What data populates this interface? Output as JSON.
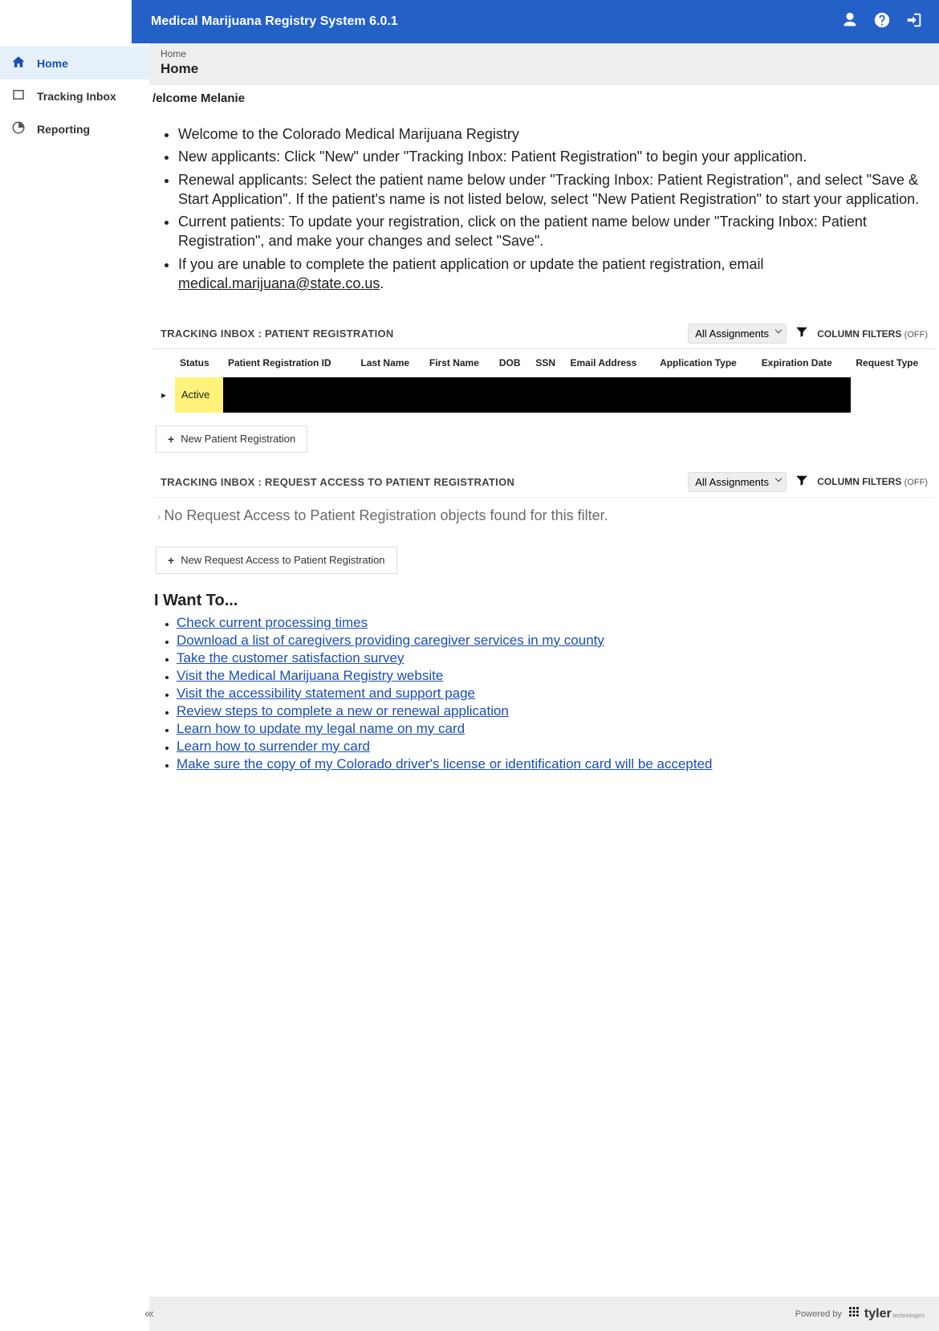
{
  "header": {
    "title": "Medical Marijuana Registry System 6.0.1"
  },
  "sidebar": {
    "items": [
      {
        "label": "Home",
        "active": true
      },
      {
        "label": "Tracking Inbox",
        "active": false
      },
      {
        "label": "Reporting",
        "active": false
      }
    ]
  },
  "breadcrumb": "Home",
  "page_title": "Home",
  "welcome_user": "/elcome Melanie",
  "bullets": [
    "Welcome to the Colorado Medical Marijuana Registry",
    "New applicants: Click \"New\" under \"Tracking Inbox: Patient Registration\" to begin your application.",
    "Renewal applicants: Select the patient name below under \"Tracking Inbox: Patient Registration\", and select \"Save & Start Application\". If the patient's name is not listed below, select \"New Patient Registration\" to start your application.",
    "Current patients: To update your registration, click on the patient name below under \"Tracking Inbox: Patient Registration\", and make your changes and select \"Save\"."
  ],
  "bullet_email_prefix": "If you are unable to complete the patient application or update the patient registration, email ",
  "bullet_email": "medical.marijuana@state.co.us",
  "bullet_email_suffix": ".",
  "inbox1": {
    "title": "TRACKING INBOX : PATIENT REGISTRATION",
    "assignments": "All Assignments",
    "col_filters_label": "COLUMN FILTERS ",
    "col_filters_state": "(OFF)",
    "columns": [
      "",
      "Status",
      "Patient Registration ID",
      "Last Name",
      "First Name",
      "DOB",
      "SSN",
      "Email Address",
      "Application Type",
      "Expiration Date",
      "Request Type"
    ],
    "row_status": "Active",
    "new_button": "New Patient Registration"
  },
  "inbox2": {
    "title": "TRACKING INBOX : REQUEST ACCESS TO PATIENT REGISTRATION",
    "assignments": "All Assignments",
    "col_filters_label": "COLUMN FILTERS ",
    "col_filters_state": "(OFF)",
    "no_results": "No Request Access to Patient Registration objects found for this filter.",
    "new_button": "New Request Access to Patient Registration"
  },
  "want_heading": "I Want To...",
  "want_links": [
    "Check current processing times",
    "Download a list of caregivers providing caregiver services in my county",
    "Take the customer satisfaction survey",
    "Visit the Medical Marijuana Registry website",
    "Visit the accessibility statement and support page",
    "Review steps to complete a new or renewal application",
    "Learn how to update my legal name on my card",
    "Learn how to surrender my card",
    "Make sure the copy of my Colorado driver's license or identification card will be accepted"
  ],
  "footer": {
    "powered_by": "Powered by",
    "brand": "tyler",
    "brand_sub": "technologies"
  }
}
